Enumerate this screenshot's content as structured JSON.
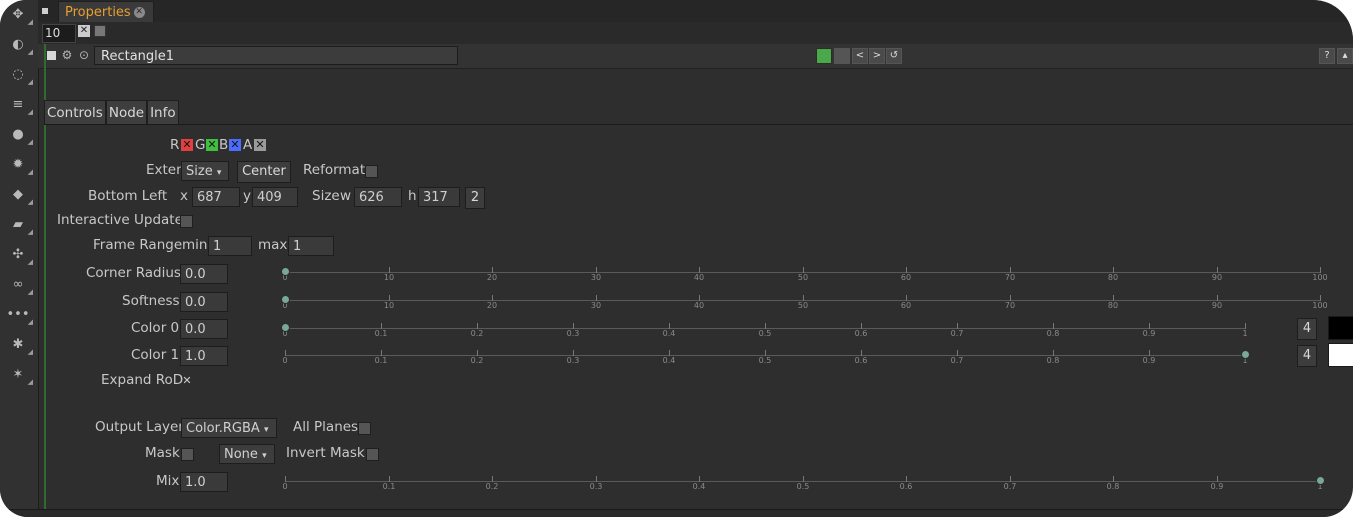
{
  "tab": {
    "label": "Properties"
  },
  "max_panels": "10",
  "node": {
    "name": "Rectangle1"
  },
  "subtabs": [
    "Controls",
    "Node",
    "Info"
  ],
  "channels": [
    "R",
    "G",
    "B",
    "A"
  ],
  "extent": {
    "label": "Extent",
    "value": "Size",
    "center_label": "Center",
    "reformat_label": "Reformat"
  },
  "bottom_left": {
    "label": "Bottom Left",
    "x_label": "x",
    "x": "687",
    "y_label": "y",
    "y": "409"
  },
  "size": {
    "label": "Size",
    "w_label": "w",
    "w": "626",
    "h_label": "h",
    "h": "317",
    "dim_btn": "2"
  },
  "interactive_update": {
    "label": "Interactive Update"
  },
  "frame_range": {
    "label": "Frame Range",
    "min_label": "min",
    "min": "1",
    "max_label": "max",
    "max": "1"
  },
  "corner_radius": {
    "label": "Corner Radius",
    "value": "0.0",
    "ticks": [
      "0",
      "10",
      "20",
      "30",
      "40",
      "50",
      "60",
      "70",
      "80",
      "90",
      "100"
    ],
    "level": 0
  },
  "softness": {
    "label": "Softness",
    "value": "0.0",
    "ticks": [
      "0",
      "10",
      "20",
      "30",
      "40",
      "50",
      "60",
      "70",
      "80",
      "90",
      "100"
    ],
    "level": 0
  },
  "color0": {
    "label": "Color 0",
    "value": "0.0",
    "ticks": [
      "0",
      "0.1",
      "0.2",
      "0.3",
      "0.4",
      "0.5",
      "0.6",
      "0.7",
      "0.8",
      "0.9",
      "1"
    ],
    "level": 0,
    "dim_btn": "4",
    "swatch": "#000000"
  },
  "color1": {
    "label": "Color 1",
    "value": "1.0",
    "ticks": [
      "0",
      "0.1",
      "0.2",
      "0.3",
      "0.4",
      "0.5",
      "0.6",
      "0.7",
      "0.8",
      "0.9",
      "1"
    ],
    "level": 1,
    "dim_btn": "4",
    "swatch": "#ffffff"
  },
  "expand_rod": {
    "label": "Expand RoD"
  },
  "output_layer": {
    "label": "Output Layer",
    "value": "Color.RGBA",
    "all_planes_label": "All Planes"
  },
  "mask": {
    "label": "Mask",
    "value": "None",
    "invert_label": "Invert Mask"
  },
  "mix": {
    "label": "Mix",
    "value": "1.0",
    "ticks": [
      "0",
      "0.1",
      "0.2",
      "0.3",
      "0.4",
      "0.5",
      "0.6",
      "0.7",
      "0.8",
      "0.9",
      "1"
    ],
    "level": 1
  },
  "colors": {
    "accent_orange": "#e8a030",
    "red": "#e04040",
    "green": "#40c040",
    "blue": "#4a6cff",
    "knob": "#79a89a"
  },
  "icons": [
    "pin-icon",
    "close-icon",
    "settings-icon",
    "center-icon",
    "prev-icon",
    "next-icon",
    "help-icon"
  ]
}
